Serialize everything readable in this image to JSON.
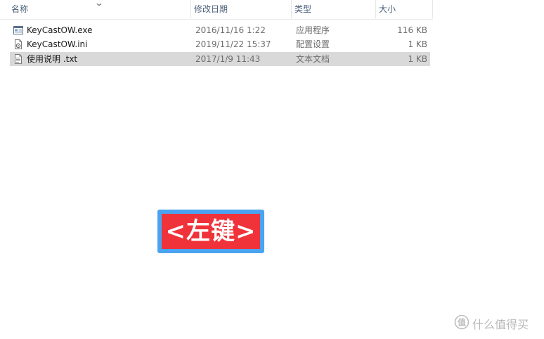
{
  "columns": {
    "name": "名称",
    "date": "修改日期",
    "type": "类型",
    "size": "大小"
  },
  "files": [
    {
      "name": "KeyCastOW.exe",
      "date": "2016/11/16 1:22",
      "type": "应用程序",
      "size": "116 KB",
      "icon": "exe-app-icon",
      "selected": false
    },
    {
      "name": "KeyCastOW.ini",
      "date": "2019/11/22 15:37",
      "type": "配置设置",
      "size": "1 KB",
      "icon": "ini-settings-file-icon",
      "selected": false
    },
    {
      "name": "使用说明 .txt",
      "date": "2017/1/9 11:43",
      "type": "文本文档",
      "size": "1 KB",
      "icon": "text-document-icon",
      "selected": true
    }
  ],
  "overlay": {
    "key_label": "<左键>"
  },
  "watermark": {
    "text": "什么值得买",
    "logo": "smzdm-logo"
  },
  "colors": {
    "badge_red": "#f0333a",
    "badge_border": "#4aa3f0",
    "selected_row": "#d9d9d9",
    "header_text": "#4c607a"
  }
}
